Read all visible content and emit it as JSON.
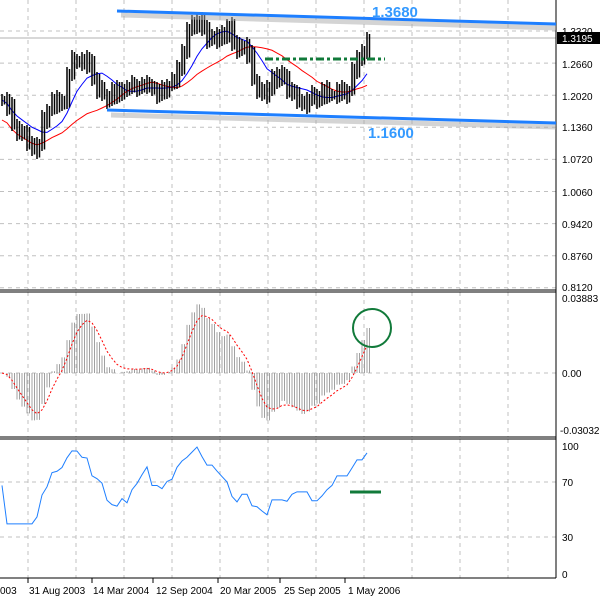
{
  "chart_data": {
    "type": "line",
    "title": "",
    "main": {
      "style": "ohlc-bars",
      "closes": [
        1.194,
        1.18,
        1.144,
        1.13,
        1.124,
        1.11,
        1.094,
        1.104,
        1.154,
        1.174,
        1.194,
        1.184,
        1.194,
        1.244,
        1.274,
        1.274,
        1.264,
        1.274,
        1.234,
        1.214,
        1.204,
        1.194,
        1.214,
        1.204,
        1.218,
        1.218,
        1.224,
        1.218,
        1.224,
        1.224,
        1.214,
        1.204,
        1.214,
        1.224,
        1.234,
        1.254,
        1.294,
        1.334,
        1.344,
        1.354,
        1.334,
        1.314,
        1.324,
        1.314,
        1.324,
        1.344,
        1.304,
        1.294,
        1.304,
        1.284,
        1.234,
        1.214,
        1.204,
        1.214,
        1.244,
        1.234,
        1.244,
        1.214,
        1.204,
        1.194,
        1.184,
        1.194,
        1.204,
        1.194,
        1.214,
        1.204,
        1.204,
        1.214,
        1.204,
        1.214,
        1.254,
        1.274,
        1.294,
        1.314
      ],
      "ma_fast_color": "#0000ff",
      "ma_slow_color": "#ff0000",
      "ylim": [
        0.812,
        1.334
      ],
      "y_ticks": [
        "1.3320",
        "1.2660",
        "1.2020",
        "1.1360",
        "1.0720",
        "1.0060",
        "0.9420",
        "0.8760",
        "0.8120"
      ],
      "current_price": "1.3195",
      "channel_upper_label": "1.3680",
      "channel_lower_label": "1.1600",
      "channel_color": "#1e7fff",
      "resistance_color": "#117a3a"
    },
    "macd": {
      "y_ticks": [
        "0.03883",
        "0.00",
        "-0.03032"
      ],
      "ylim": [
        -0.03032,
        0.03883
      ],
      "histogram_color": "#a0a0a0",
      "signal_color": "#ff0000"
    },
    "rsi": {
      "y_ticks": [
        "100",
        "70",
        "30",
        "0"
      ],
      "ylim": [
        0,
        100
      ],
      "color": "#1e7fff"
    },
    "x_ticks": [
      "003",
      "31 Aug 2003",
      "14 Mar 2004",
      "12 Sep 2004",
      "20 Mar 2005",
      "25 Sep 2005",
      "1 May 2006"
    ]
  }
}
